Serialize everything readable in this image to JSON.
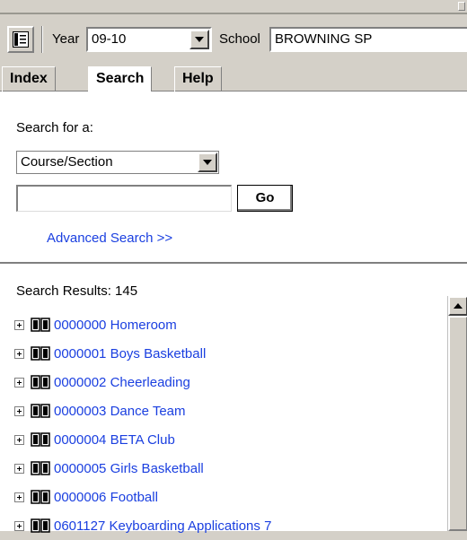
{
  "toolbar": {
    "year_label": "Year",
    "year_value": "09-10",
    "school_label": "School",
    "school_value": "BROWNING SP"
  },
  "tabs": [
    {
      "label": "Index",
      "active": false
    },
    {
      "label": "Search",
      "active": true
    },
    {
      "label": "Help",
      "active": false
    }
  ],
  "search": {
    "search_for_label": "Search for a:",
    "type_value": "Course/Section",
    "input_value": "",
    "go_label": "Go",
    "advanced_link": "Advanced Search >>"
  },
  "results": {
    "count_text": "Search Results: 145",
    "items": [
      "0000000 Homeroom",
      "0000001 Boys Basketball",
      "0000002 Cheerleading",
      "0000003 Dance Team",
      "0000004 BETA Club",
      "0000005 Girls Basketball",
      "0000006 Football",
      "0601127 Keyboarding Applications 7"
    ]
  },
  "colors": {
    "link": "#1a3fe0",
    "chrome": "#d4d0c8"
  },
  "icons": {
    "menu": "menu-panel-icon",
    "expand": "expand-plus-icon",
    "course": "book-icon"
  }
}
